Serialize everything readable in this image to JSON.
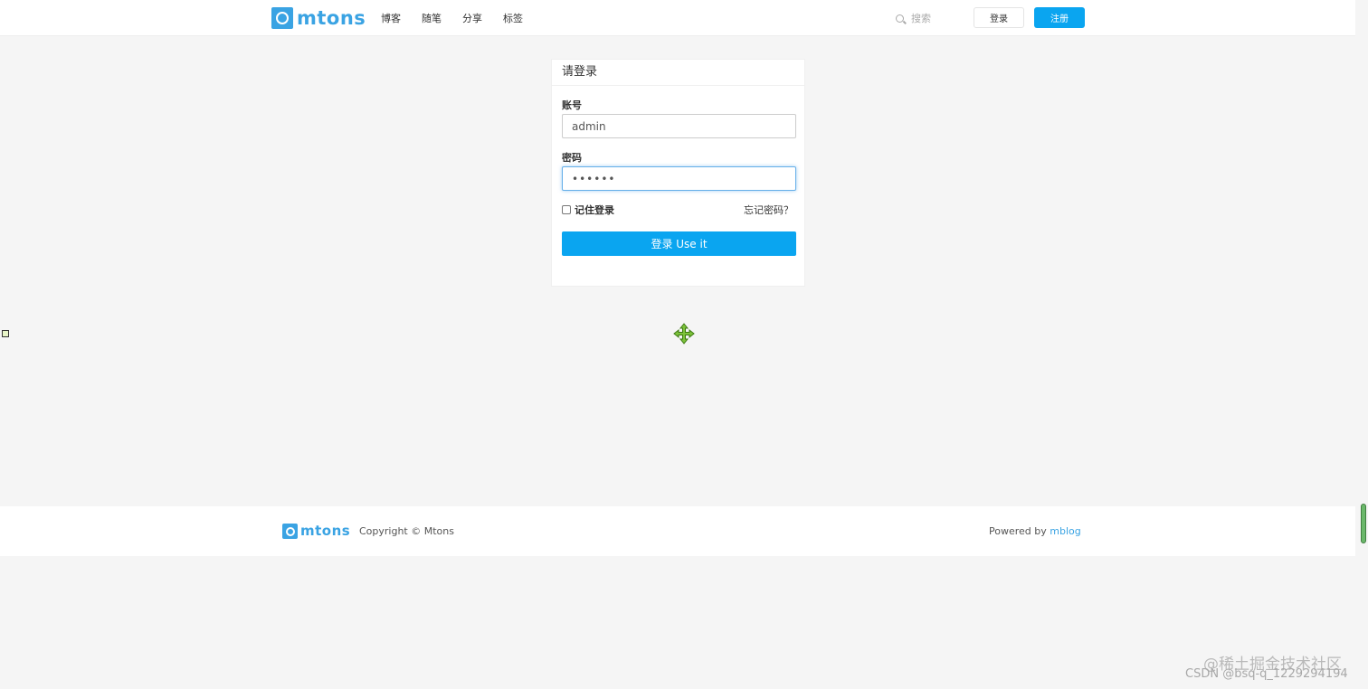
{
  "header": {
    "logo_text": "mtons",
    "nav": [
      "博客",
      "随笔",
      "分享",
      "标签"
    ],
    "search_placeholder": "搜索",
    "login_label": "登录",
    "register_label": "注册"
  },
  "login_panel": {
    "title": "请登录",
    "account_label": "账号",
    "account_value": "admin",
    "password_label": "密码",
    "password_value": "••••••",
    "remember_label": "记住登录",
    "forgot_label": "忘记密码？",
    "submit_label": "登录 Use it"
  },
  "footer": {
    "logo_text": "mtons",
    "copyright": "Copyright © Mtons",
    "powered_prefix": "Powered by ",
    "powered_link": "mblog"
  },
  "watermarks": {
    "line1": "@稀土掘金技术社区",
    "line2": "CSDN @bsq-q_1229294194"
  },
  "colors": {
    "brand": "#3aa3e3",
    "primary_button": "#0aa5f0",
    "background": "#f5f5f5"
  },
  "icons": {
    "search": "search-icon",
    "move_cursor": "move-cursor-icon"
  }
}
